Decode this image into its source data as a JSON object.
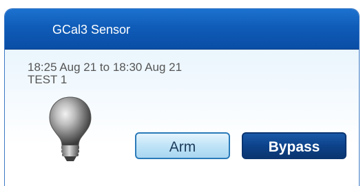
{
  "panel": {
    "title": "GCal3 Sensor",
    "date_range": "18:25 Aug 21 to 18:30 Aug 21",
    "sensor_name": "TEST 1",
    "status_icon": "lightbulb-off-icon",
    "arm_label": "Arm",
    "bypass_label": "Bypass"
  },
  "colors": {
    "header_blue": "#0f5cb8",
    "arm_button_bg": "#bfe3f7",
    "bypass_button_bg": "#0d428a"
  }
}
